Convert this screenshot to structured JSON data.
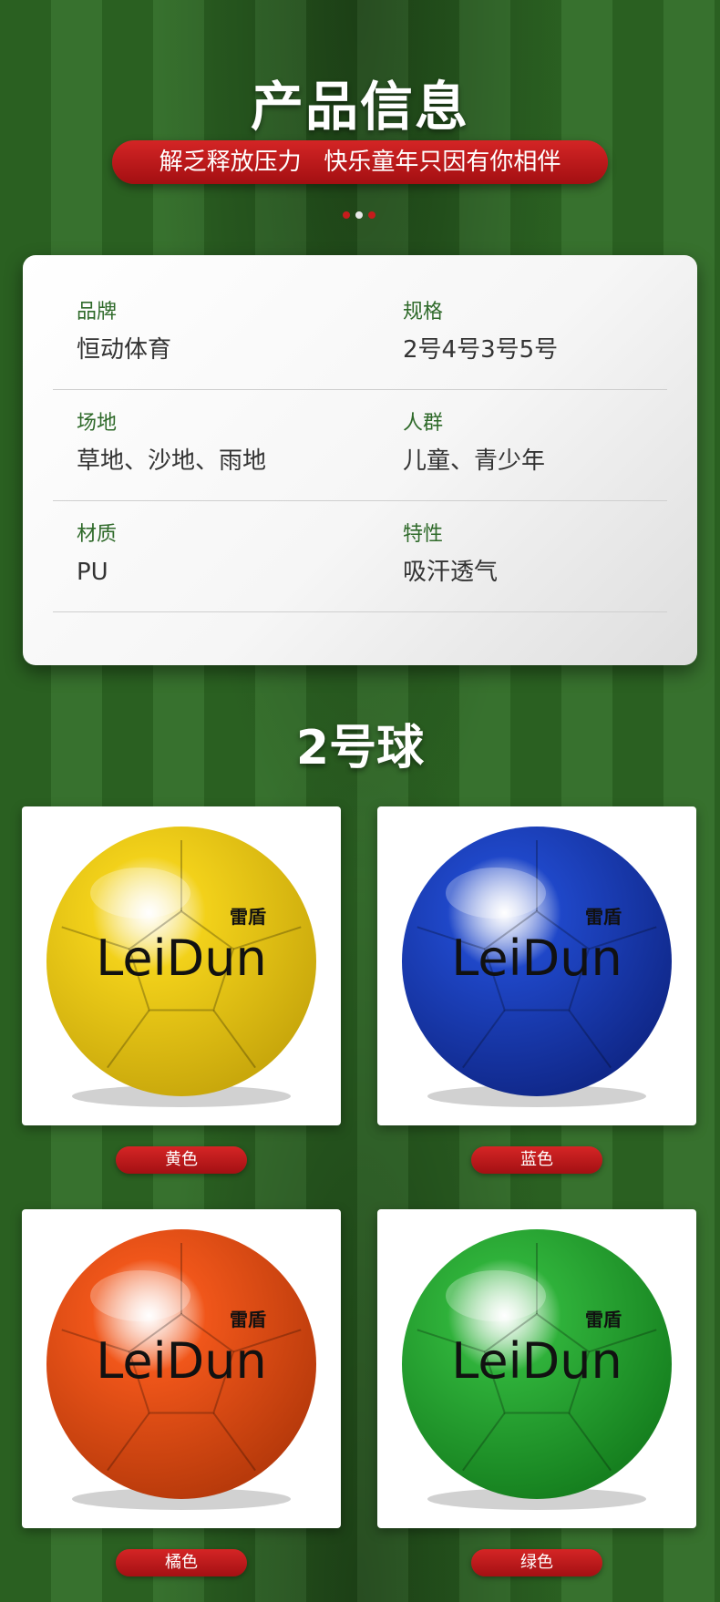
{
  "header": {
    "title": "产品信息",
    "slogan": "解乏释放压力   快乐童年只因有你相伴"
  },
  "info": [
    [
      {
        "label": "品牌",
        "value": "恒动体育"
      },
      {
        "label": "规格",
        "value": "2号4号3号5号"
      }
    ],
    [
      {
        "label": "场地",
        "value": "草地、沙地、雨地"
      },
      {
        "label": "人群",
        "value": "儿童、青少年"
      }
    ],
    [
      {
        "label": "材质",
        "value": "PU"
      },
      {
        "label": "特性",
        "value": "吸汗透气"
      }
    ]
  ],
  "section": {
    "title": "2号球"
  },
  "products": [
    {
      "color_name": "黄色",
      "ball_color": "#f2d11a",
      "ball_shade": "#c9a80c",
      "brand_cn": "雷盾",
      "brand_en": "LeiDun"
    },
    {
      "color_name": "蓝色",
      "ball_color": "#1f47c8",
      "ball_shade": "#10288a",
      "brand_cn": "雷盾",
      "brand_en": "LeiDun"
    },
    {
      "color_name": "橘色",
      "ball_color": "#f0561a",
      "ball_shade": "#b83a0b",
      "brand_cn": "雷盾",
      "brand_en": "LeiDun"
    },
    {
      "color_name": "绿色",
      "ball_color": "#2fb13a",
      "ball_shade": "#16801f",
      "brand_cn": "雷盾",
      "brand_en": "LeiDun"
    }
  ]
}
